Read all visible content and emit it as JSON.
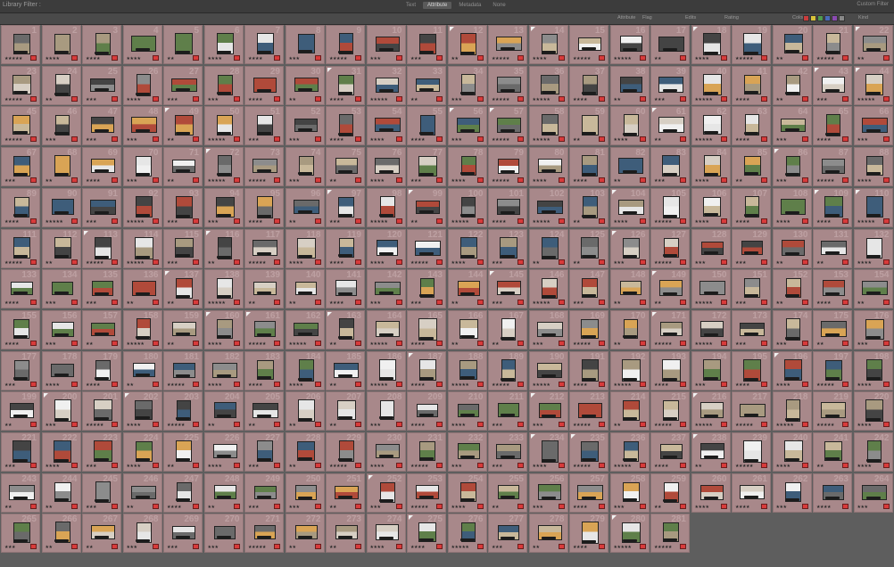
{
  "topbar": {
    "title": "Library Filter :",
    "tabs": [
      {
        "label": "Text",
        "selected": false
      },
      {
        "label": "Attribute",
        "selected": true
      },
      {
        "label": "Metadata",
        "selected": false
      },
      {
        "label": "None",
        "selected": false
      }
    ],
    "preset": "Custom Filter"
  },
  "filterbar": {
    "attribute_label": "Attribute",
    "flag_label": "Flag",
    "edits_label": "Edits",
    "rating_label": "Rating",
    "color_label": "Color",
    "kind_label": "Kind",
    "color_swatches": [
      "#c83c3c",
      "#d8c23a",
      "#4f9a4f",
      "#4a6ab8",
      "#8a4ab0",
      "#888888"
    ]
  },
  "grid": {
    "columns": 22,
    "start_number": 1,
    "total": 281,
    "cell_color": "#a8888a",
    "label_color": "#d83b3b",
    "thumb_palette": [
      "#e6e6e6",
      "#d7cfc4",
      "#8c8c8c",
      "#6a6a6a",
      "#b04a3a",
      "#d9a455",
      "#5f7f4a",
      "#3e5d7a",
      "#f0f0f0",
      "#a89a80",
      "#444444",
      "#c8b89a"
    ]
  }
}
